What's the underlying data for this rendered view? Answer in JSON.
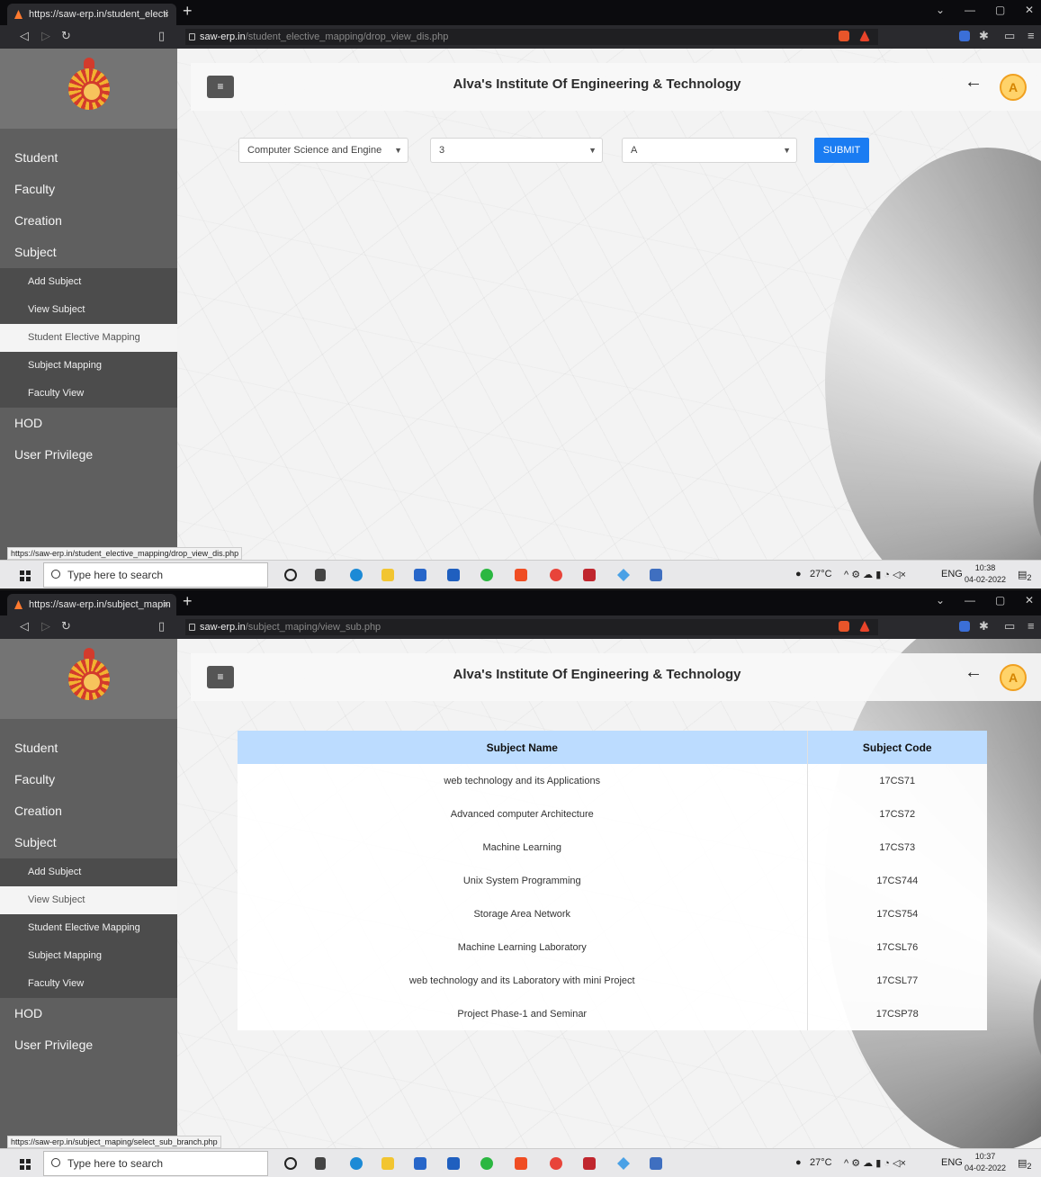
{
  "screenshots": [
    {
      "tab": {
        "title": "https://saw-erp.in/student_electi",
        "close": "×"
      },
      "address": {
        "host": "saw-erp.in",
        "path": "/student_elective_mapping/drop_view_dis.php"
      },
      "header": {
        "title": "Alva's Institute Of Engineering & Technology",
        "avatar_letter": "A"
      },
      "sidebar": {
        "items": [
          "Student",
          "Faculty",
          "Creation",
          "Subject"
        ],
        "subject_sub": [
          "Add Subject",
          "View Subject",
          "Student Elective Mapping",
          "Subject Mapping",
          "Faculty View"
        ],
        "items_after": [
          "HOD",
          "User Privilege"
        ]
      },
      "filters": {
        "branch": "Computer Science and Engine",
        "semester": "3",
        "section": "A",
        "submit_label": "SUBMIT"
      },
      "status_url": "https://saw-erp.in/student_elective_mapping/drop_view_dis.php",
      "taskbar": {
        "search_placeholder": "Type here to search",
        "temp": "27°C",
        "lang": "ENG",
        "time": "10:38",
        "date": "04-02-2022",
        "notif": "2"
      }
    },
    {
      "tab": {
        "title": "https://saw-erp.in/subject_mapin",
        "close": "×"
      },
      "address": {
        "host": "saw-erp.in",
        "path": "/subject_maping/view_sub.php"
      },
      "header": {
        "title": "Alva's Institute Of Engineering & Technology",
        "avatar_letter": "A"
      },
      "sidebar": {
        "items": [
          "Student",
          "Faculty",
          "Creation",
          "Subject"
        ],
        "subject_sub": [
          "Add Subject",
          "View Subject",
          "Student Elective Mapping",
          "Subject Mapping",
          "Faculty View"
        ],
        "items_after": [
          "HOD",
          "User Privilege"
        ]
      },
      "table": {
        "headers": [
          "Subject Name",
          "Subject Code"
        ],
        "rows": [
          [
            "web technology and its Applications",
            "17CS71"
          ],
          [
            "Advanced computer Architecture",
            "17CS72"
          ],
          [
            "Machine Learning",
            "17CS73"
          ],
          [
            "Unix System Programming",
            "17CS744"
          ],
          [
            "Storage Area Network",
            "17CS754"
          ],
          [
            "Machine Learning Laboratory",
            "17CSL76"
          ],
          [
            "web technology and its Laboratory with mini Project",
            "17CSL77"
          ],
          [
            "Project Phase-1 and Seminar",
            "17CSP78"
          ]
        ]
      },
      "status_url": "https://saw-erp.in/subject_maping/select_sub_branch.php",
      "taskbar": {
        "search_placeholder": "Type here to search",
        "temp": "27°C",
        "lang": "ENG",
        "time": "10:37",
        "date": "04-02-2022",
        "notif": "2"
      }
    }
  ],
  "colors": {
    "sidebar": "#5f5f5f",
    "submenu": "#4c4c4c",
    "accent": "#1a7cf2",
    "table_header": "#bcdcff",
    "avatar": "#ffd36a"
  }
}
